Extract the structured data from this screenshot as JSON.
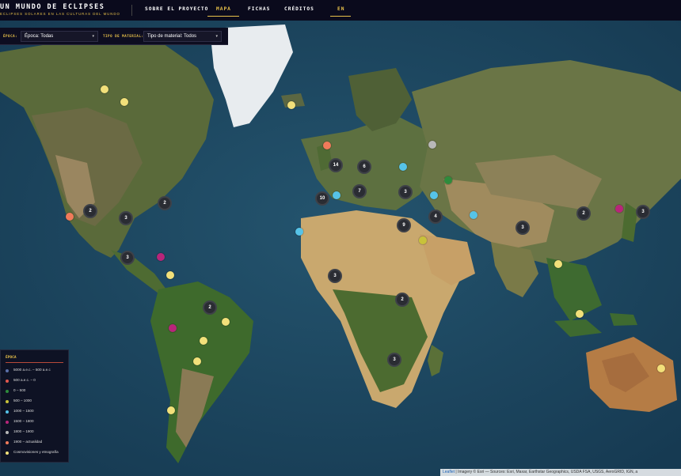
{
  "header": {
    "title": "UN MUNDO DE ECLIPSES",
    "subtitle": "ECLIPSES SOLARES EN LAS CULTURAS DEL MUNDO",
    "nav": [
      {
        "label": "SOBRE EL PROYECTO",
        "active": false
      },
      {
        "label": "MAPA",
        "active": true
      },
      {
        "label": "FICHAS",
        "active": false
      },
      {
        "label": "CRÉDITOS",
        "active": false
      },
      {
        "label": "EN",
        "active": false
      }
    ],
    "accent_color": "#e8c14a"
  },
  "filters": {
    "epoch_label": "ÉPOCA:",
    "epoch_value": "Época: Todas",
    "material_label": "TIPO DE MATERIAL:",
    "material_value": "Tipo de material: Todos"
  },
  "legend": {
    "title": "ÉPOCA",
    "items": [
      {
        "label": "5000 a.e.c. – 500 a.e.c",
        "color": "#5b6fa8"
      },
      {
        "label": "500 a.e.c. – 0",
        "color": "#e2584e"
      },
      {
        "label": "0 – 500",
        "color": "#2e8b3c"
      },
      {
        "label": "500 – 1000",
        "color": "#c8c23a"
      },
      {
        "label": "1000 – 1500",
        "color": "#56c3e8"
      },
      {
        "label": "1500 – 1800",
        "color": "#b8257a"
      },
      {
        "label": "1800 – 1900",
        "color": "#b8b8b8"
      },
      {
        "label": "1900 – actualidad",
        "color": "#f07a5a"
      },
      {
        "label": "Cosmovisiones y etnografía",
        "color": "#f2e07a"
      }
    ]
  },
  "clusters": [
    {
      "count": "2"
    },
    {
      "count": "3"
    },
    {
      "count": "2"
    },
    {
      "count": "3"
    },
    {
      "count": "3"
    },
    {
      "count": "2"
    },
    {
      "count": "14"
    },
    {
      "count": "6"
    },
    {
      "count": "10"
    },
    {
      "count": "7"
    },
    {
      "count": "3"
    },
    {
      "count": "4"
    },
    {
      "count": "9"
    },
    {
      "count": "3"
    },
    {
      "count": "2"
    },
    {
      "count": "3"
    },
    {
      "count": "2"
    },
    {
      "count": "3"
    },
    {
      "count": "3"
    }
  ],
  "markers": [
    {
      "color": "#f2e07a"
    },
    {
      "color": "#f2e07a"
    },
    {
      "color": "#f2e07a"
    },
    {
      "color": "#f07a5a"
    },
    {
      "color": "#b8257a"
    },
    {
      "color": "#f2e07a"
    },
    {
      "color": "#b8257a"
    },
    {
      "color": "#f2e07a"
    },
    {
      "color": "#f2e07a"
    },
    {
      "color": "#f2e07a"
    },
    {
      "color": "#f2e07a"
    },
    {
      "color": "#f07a5a"
    },
    {
      "color": "#b8b8b8"
    },
    {
      "color": "#56c3e8"
    },
    {
      "color": "#56c3e8"
    },
    {
      "color": "#56c3e8"
    },
    {
      "color": "#2e8b3c"
    },
    {
      "color": "#56c3e8"
    },
    {
      "color": "#56c3e8"
    },
    {
      "color": "#c8c23a"
    },
    {
      "color": "#b8257a"
    },
    {
      "color": "#f2e07a"
    },
    {
      "color": "#f2e07a"
    },
    {
      "color": "#f2e07a"
    }
  ],
  "attribution": {
    "leaflet": "Leaflet",
    "text": "| Imagery © Esri — Sources: Esri, Maxar, Earthstar Geographics, USDA FSA, USGS, AeroGRID, IGN, a"
  }
}
